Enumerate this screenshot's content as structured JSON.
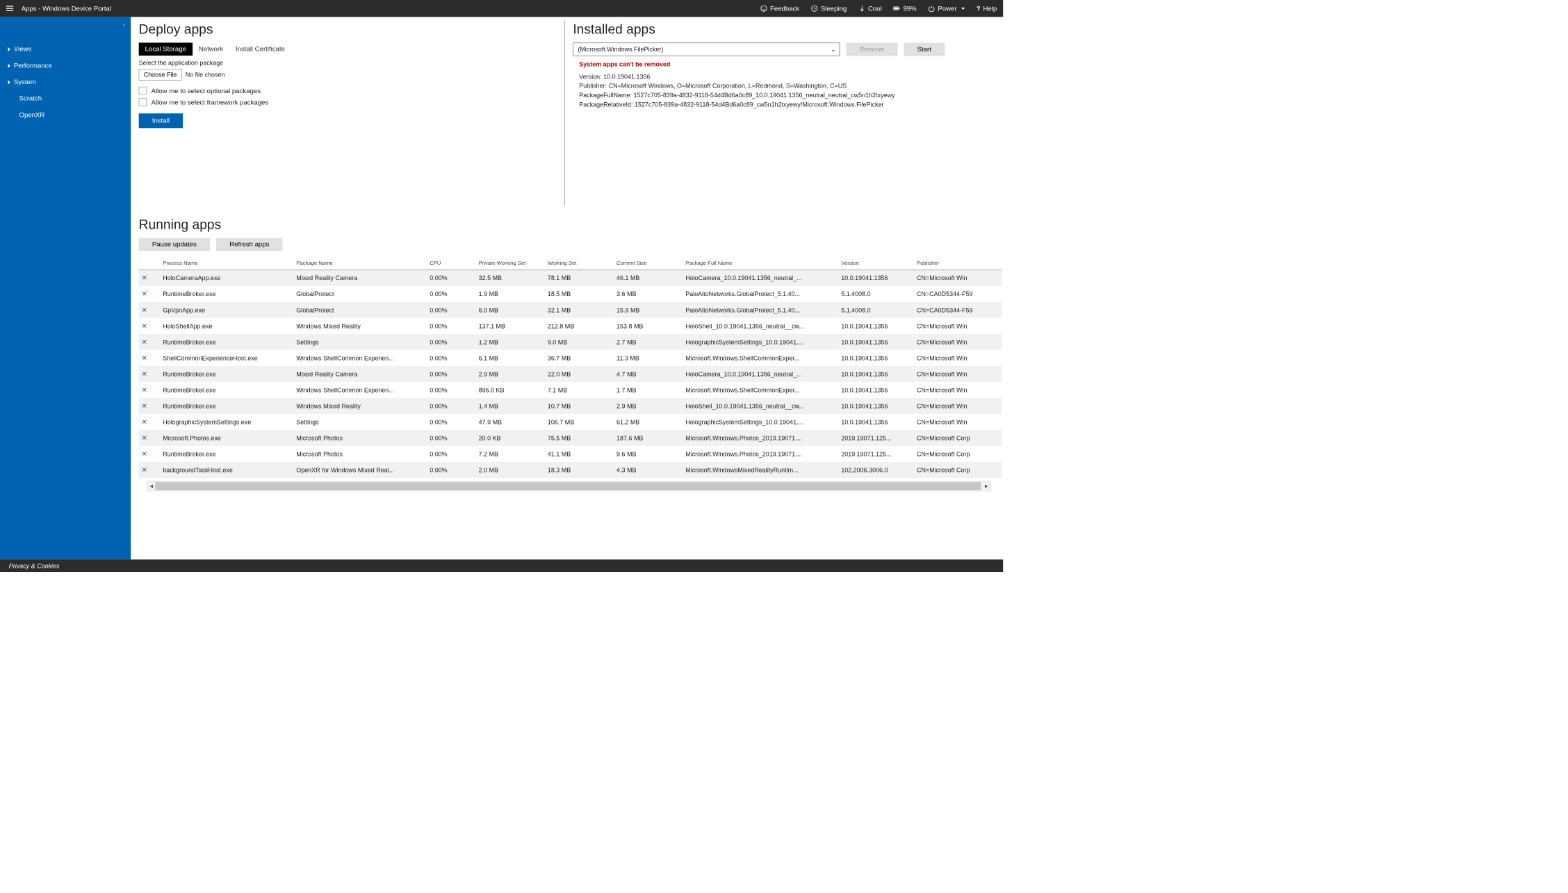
{
  "topbar": {
    "title": "Apps - Windows Device Portal",
    "feedback": "Feedback",
    "sleeping": "Sleeping",
    "cool": "Cool",
    "battery": "99%",
    "power": "Power",
    "help": "Help"
  },
  "sidebar": {
    "items": [
      {
        "label": "Views",
        "caret": true
      },
      {
        "label": "Performance",
        "caret": true
      },
      {
        "label": "System",
        "caret": true
      },
      {
        "label": "Scratch",
        "caret": false,
        "indent": true
      },
      {
        "label": "OpenXR",
        "caret": false,
        "indent": true
      }
    ]
  },
  "deploy": {
    "heading": "Deploy apps",
    "tabs": [
      "Local Storage",
      "Network",
      "Install Certificate"
    ],
    "select_label": "Select the application package",
    "choose_file": "Choose File",
    "no_file": "No file chosen",
    "opt_pkg": "Allow me to select optional packages",
    "fw_pkg": "Allow me to select framework packages",
    "install": "Install"
  },
  "installed": {
    "heading": "Installed apps",
    "selected": "(Microsoft.Windows.FilePicker)",
    "remove": "Remove",
    "start": "Start",
    "warn": "System apps can't be removed",
    "version_label": "Version:",
    "version": "10.0.19041.1356",
    "publisher_label": "Publisher:",
    "publisher": "CN=Microsoft Windows, O=Microsoft Corporation, L=Redmond, S=Washington, C=US",
    "pfn_label": "PackageFullName:",
    "pfn": "1527c705-839a-4832-9118-54d4Bd6a0c89_10.0.19041.1356_neutral_neutral_cw5n1h2txyewy",
    "pri_label": "PackageRelativeId:",
    "pri": "1527c705-839a-4832-9118-54d4Bd6a0c89_cw5n1h2txyewy!Microsoft.Windows.FilePicker"
  },
  "running": {
    "heading": "Running apps",
    "pause": "Pause updates",
    "refresh": "Refresh apps",
    "headers": [
      "",
      "Process Name",
      "Package Name",
      "CPU",
      "Private Working Set",
      "Working Set",
      "Commit Size",
      "Package Full Name",
      "Version",
      "Publisher"
    ],
    "rows": [
      {
        "proc": "HoloCameraApp.exe",
        "pkg": "Mixed Reality Camera",
        "cpu": "0.00%",
        "pws": "32.5 MB",
        "ws": "78.1 MB",
        "cs": "46.1 MB",
        "pfn": "HoloCamera_10.0.19041.1356_neutral_...",
        "ver": "10.0.19041.1356",
        "pub": "CN=Microsoft Win"
      },
      {
        "proc": "RuntimeBroker.exe",
        "pkg": "GlobalProtect",
        "cpu": "0.00%",
        "pws": "1.9 MB",
        "ws": "18.5 MB",
        "cs": "3.6 MB",
        "pfn": "PaloAltoNetworks.GlobalProtect_5.1.40...",
        "ver": "5.1.4008.0",
        "pub": "CN=CA0D5344-F59"
      },
      {
        "proc": "GpVpnApp.exe",
        "pkg": "GlobalProtect",
        "cpu": "0.00%",
        "pws": "6.0 MB",
        "ws": "32.1 MB",
        "cs": "15.9 MB",
        "pfn": "PaloAltoNetworks.GlobalProtect_5.1.40...",
        "ver": "5.1.4008.0",
        "pub": "CN=CA0D5344-F59"
      },
      {
        "proc": "HoloShellApp.exe",
        "pkg": "Windows Mixed Reality",
        "cpu": "0.00%",
        "pws": "137.1 MB",
        "ws": "212.8 MB",
        "cs": "153.8 MB",
        "pfn": "HoloShell_10.0.19041.1356_neutral__cw...",
        "ver": "10.0.19041.1356",
        "pub": "CN=Microsoft Win"
      },
      {
        "proc": "RuntimeBroker.exe",
        "pkg": "Settings",
        "cpu": "0.00%",
        "pws": "1.2 MB",
        "ws": "9.0 MB",
        "cs": "2.7 MB",
        "pfn": "HolographicSystemSettings_10.0.19041....",
        "ver": "10.0.19041.1356",
        "pub": "CN=Microsoft Win"
      },
      {
        "proc": "ShellCommonExperienceHost.exe",
        "pkg": "Windows ShellCommon Experien...",
        "cpu": "0.00%",
        "pws": "6.1 MB",
        "ws": "36.7 MB",
        "cs": "11.3 MB",
        "pfn": "Microsoft.Windows.ShellCommonExper...",
        "ver": "10.0.19041.1356",
        "pub": "CN=Microsoft Win"
      },
      {
        "proc": "RuntimeBroker.exe",
        "pkg": "Mixed Reality Camera",
        "cpu": "0.00%",
        "pws": "2.9 MB",
        "ws": "22.0 MB",
        "cs": "4.7 MB",
        "pfn": "HoloCamera_10.0.19041.1356_neutral_...",
        "ver": "10.0.19041.1356",
        "pub": "CN=Microsoft Win"
      },
      {
        "proc": "RuntimeBroker.exe",
        "pkg": "Windows ShellCommon Experien...",
        "cpu": "0.00%",
        "pws": "896.0 KB",
        "ws": "7.1 MB",
        "cs": "1.7 MB",
        "pfn": "Microsoft.Windows.ShellCommonExper...",
        "ver": "10.0.19041.1356",
        "pub": "CN=Microsoft Win"
      },
      {
        "proc": "RuntimeBroker.exe",
        "pkg": "Windows Mixed Reality",
        "cpu": "0.00%",
        "pws": "1.4 MB",
        "ws": "10.7 MB",
        "cs": "2.9 MB",
        "pfn": "HoloShell_10.0.19041.1356_neutral__cw...",
        "ver": "10.0.19041.1356",
        "pub": "CN=Microsoft Win"
      },
      {
        "proc": "HolographicSystemSettings.exe",
        "pkg": "Settings",
        "cpu": "0.00%",
        "pws": "47.9 MB",
        "ws": "106.7 MB",
        "cs": "61.2 MB",
        "pfn": "HolographicSystemSettings_10.0.19041....",
        "ver": "10.0.19041.1356",
        "pub": "CN=Microsoft Win"
      },
      {
        "proc": "Microsoft.Photos.exe",
        "pkg": "Microsoft Photos",
        "cpu": "0.00%",
        "pws": "20.0 KB",
        "ws": "75.5 MB",
        "cs": "187.6 MB",
        "pfn": "Microsoft.Windows.Photos_2019.19071....",
        "ver": "2019.19071.125...",
        "pub": "CN=Microsoft Corp"
      },
      {
        "proc": "RuntimeBroker.exe",
        "pkg": "Microsoft Photos",
        "cpu": "0.00%",
        "pws": "7.2 MB",
        "ws": "41.1 MB",
        "cs": "9.6 MB",
        "pfn": "Microsoft.Windows.Photos_2019.19071....",
        "ver": "2019.19071.125...",
        "pub": "CN=Microsoft Corp"
      },
      {
        "proc": "backgroundTaskHost.exe",
        "pkg": "OpenXR for Windows Mixed Real...",
        "cpu": "0.00%",
        "pws": "2.0 MB",
        "ws": "18.3 MB",
        "cs": "4.3 MB",
        "pfn": "Microsoft.WindowsMixedRealityRuntim...",
        "ver": "102.2006.3006.0",
        "pub": "CN=Microsoft Corp"
      }
    ]
  },
  "footer": {
    "privacy": "Privacy & Cookies"
  }
}
